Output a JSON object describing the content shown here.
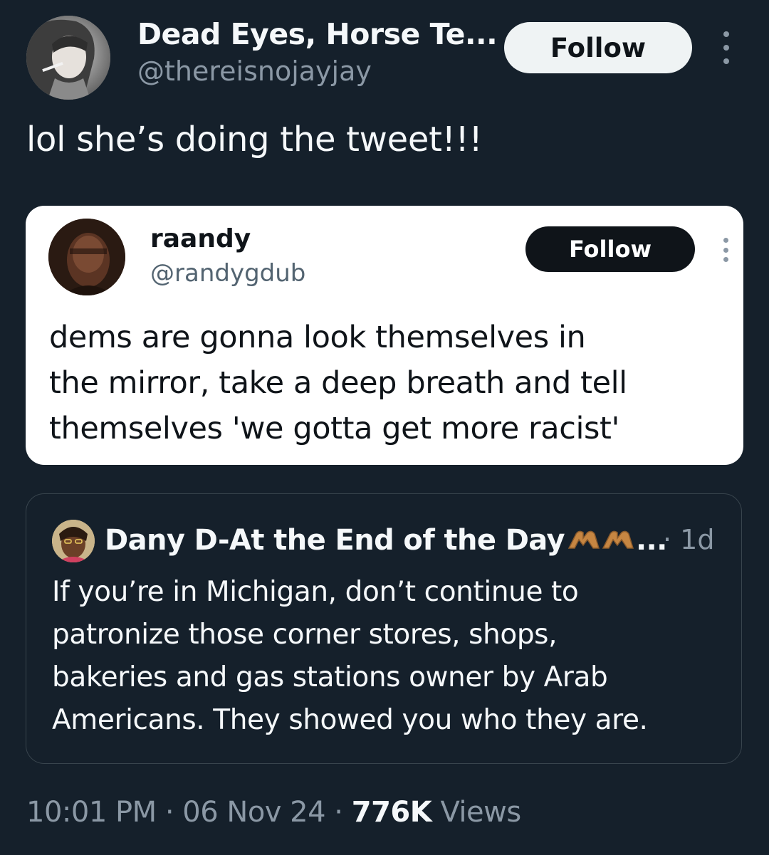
{
  "author": {
    "display_name": "Dead Eyes, Horse Te...",
    "handle": "@thereisnojayjay",
    "avatar_icon": "profile-photo-smoking-woman"
  },
  "follow_label": "Follow",
  "tweet_text": "lol she’s doing the tweet!!!",
  "embedded_image": {
    "name": "raandy",
    "handle": "@randygdub",
    "follow_label": "Follow",
    "lines": [
      "dems are gonna look themselves in",
      "the mirror, take a deep breath and tell",
      "themselves 'we gotta get more racist'"
    ]
  },
  "quoted_tweet": {
    "display_name": "Dany D-At the End of the Day",
    "name_suffix": "...",
    "time": "· 1d",
    "lines": [
      "If you’re in Michigan, don’t continue to",
      "patronize those corner stores, shops,",
      "bakeries and gas stations owner by Arab",
      "Americans. They showed you who they are."
    ]
  },
  "meta": {
    "time": "10:01 PM",
    "sep1": " · ",
    "date": "06 Nov 24",
    "sep2": " · ",
    "views_count": "776K",
    "views_label": " Views"
  },
  "colors": {
    "background": "#15202b",
    "text_primary": "#f5f8fa",
    "text_secondary": "#8b98a5",
    "border": "#38444d",
    "follow_bg": "#eff3f4",
    "heart_hands": "#c68642"
  }
}
